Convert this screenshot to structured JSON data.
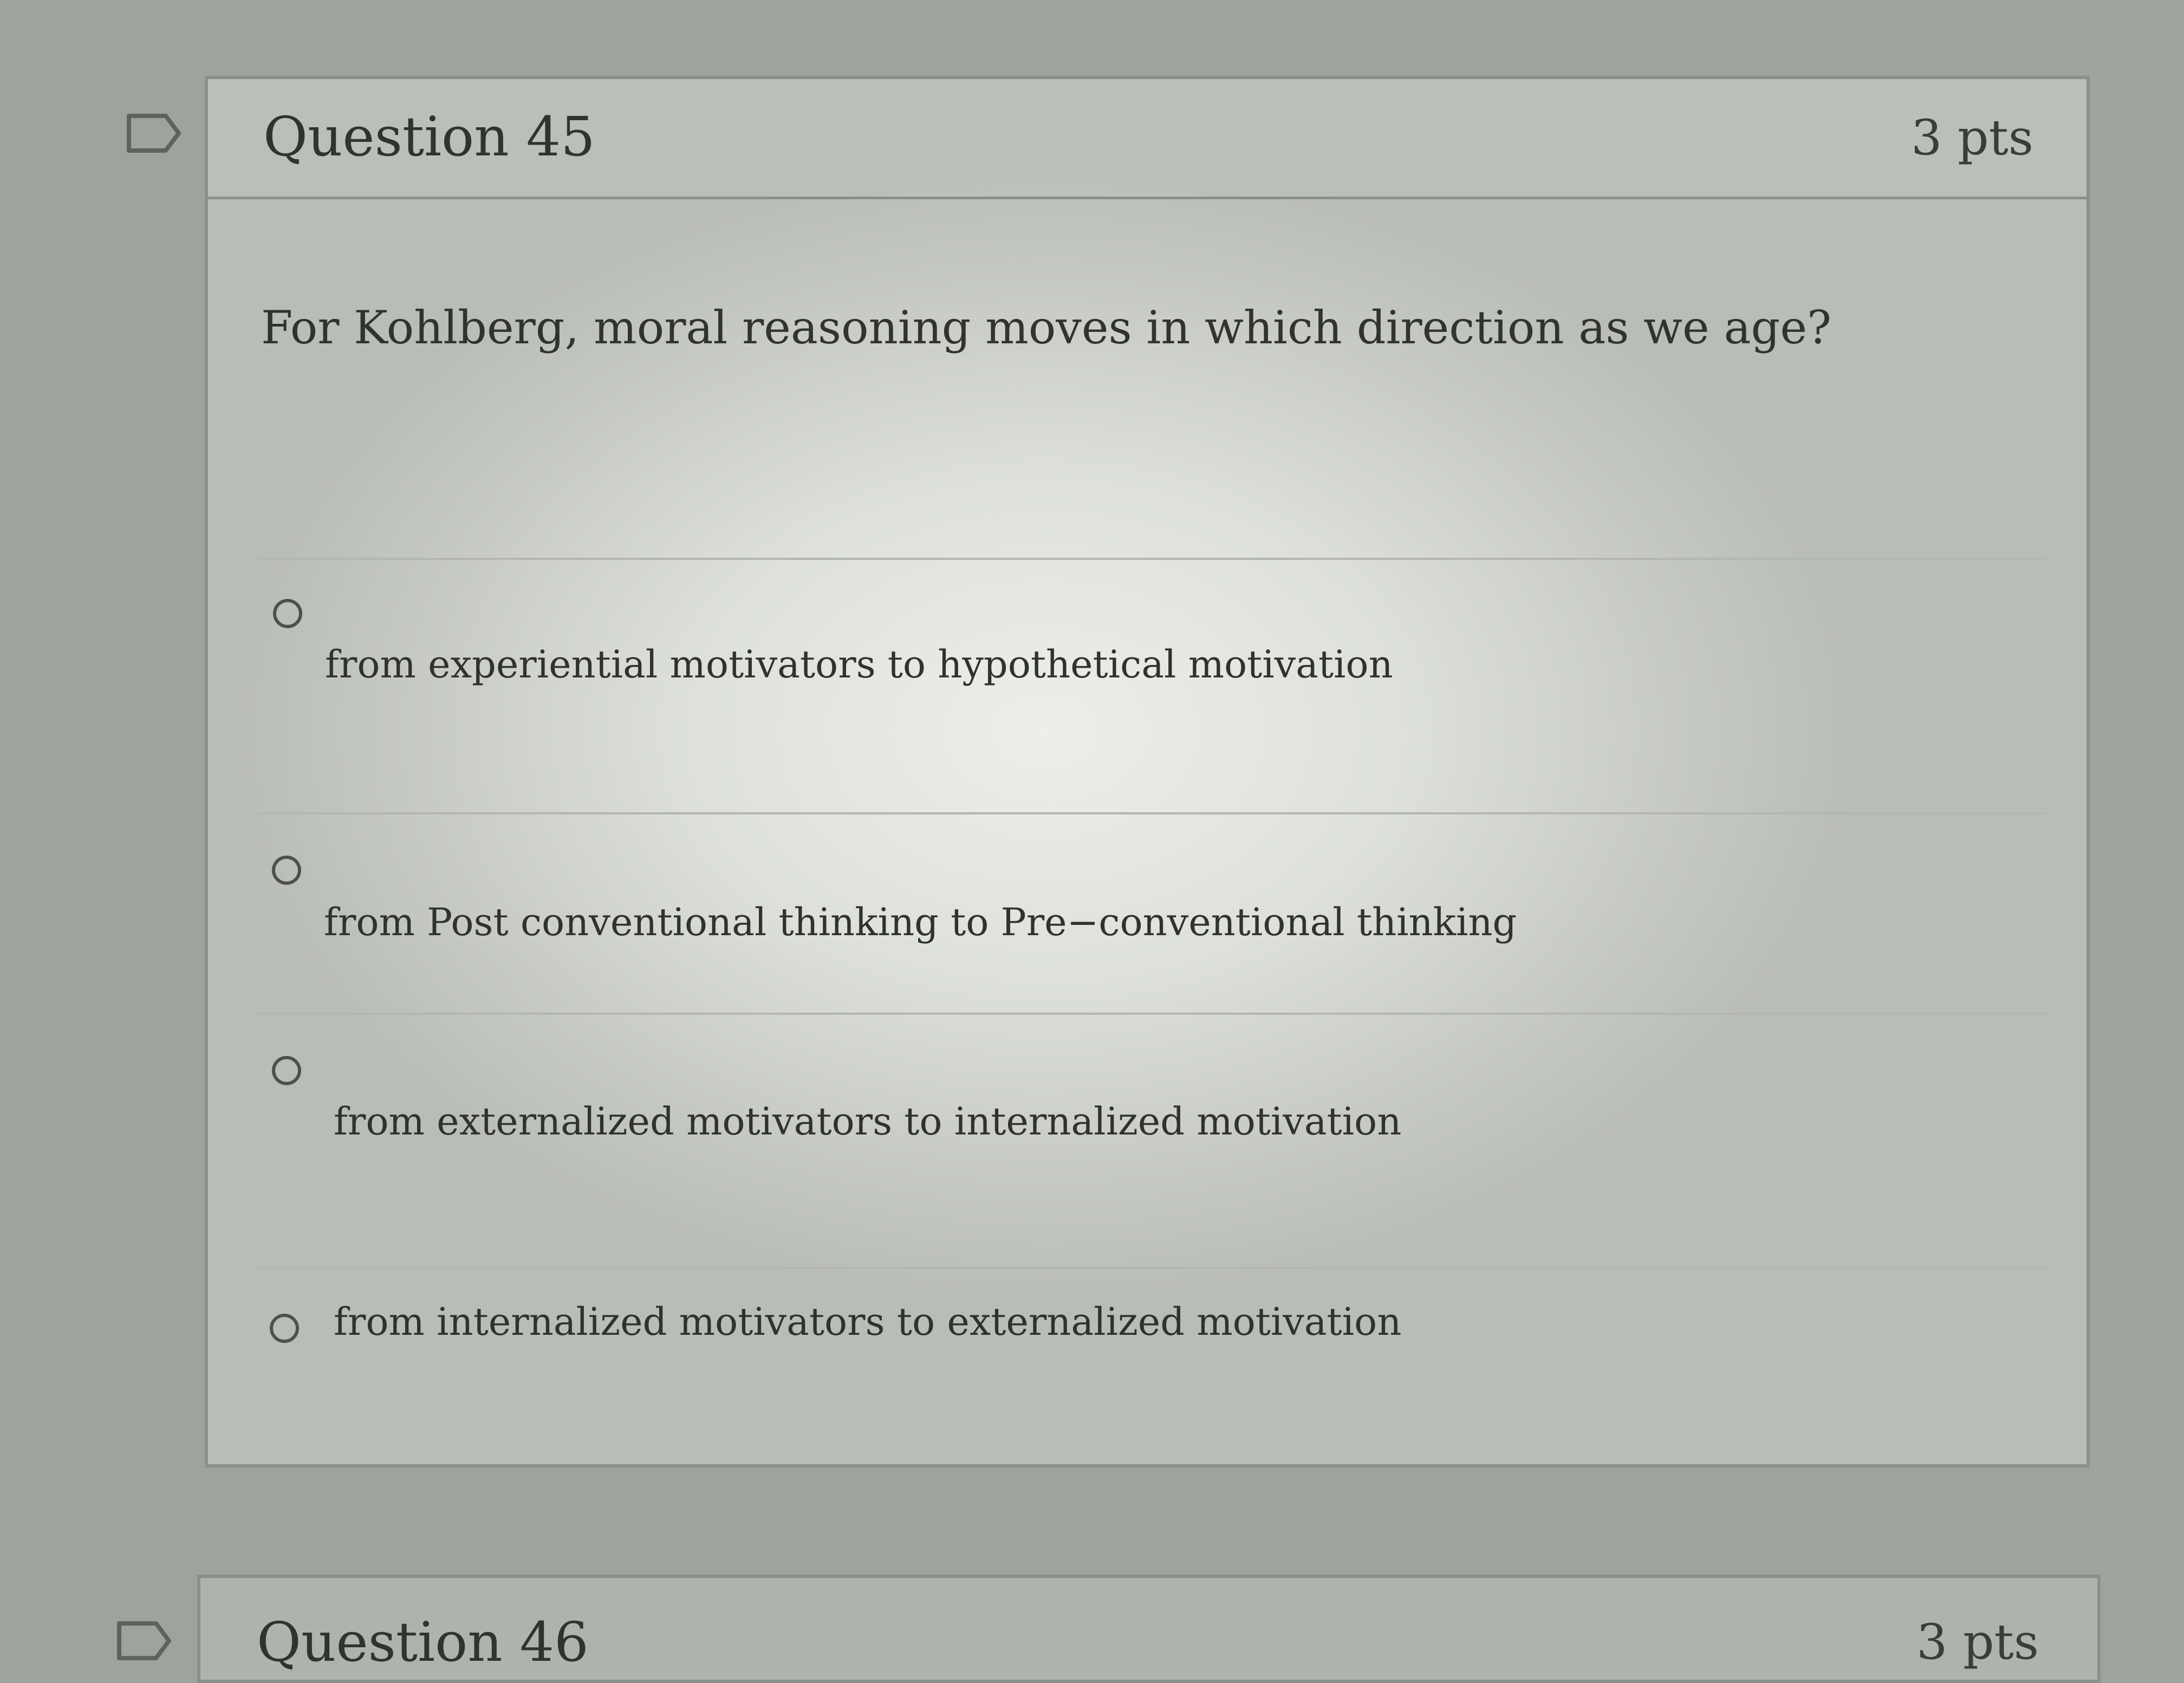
{
  "question": {
    "title": "Question 45",
    "points": "3 pts",
    "text": "For Kohlberg, moral reasoning moves in which direction as we age?",
    "flag_icon": "flag-outline-icon",
    "answers": [
      {
        "label": "from experiential motivators to hypothetical motivation",
        "selected": false
      },
      {
        "label": "from  Post conventional thinking to  Pre−conventional thinking",
        "selected": false
      },
      {
        "label": "from externalized motivators to internalized motivation",
        "selected": false
      },
      {
        "label": "from internalized motivators to externalized motivation",
        "selected": false
      }
    ]
  },
  "next_question": {
    "title": "Question 46",
    "points": "3 pts",
    "flag_icon": "flag-outline-icon"
  }
}
